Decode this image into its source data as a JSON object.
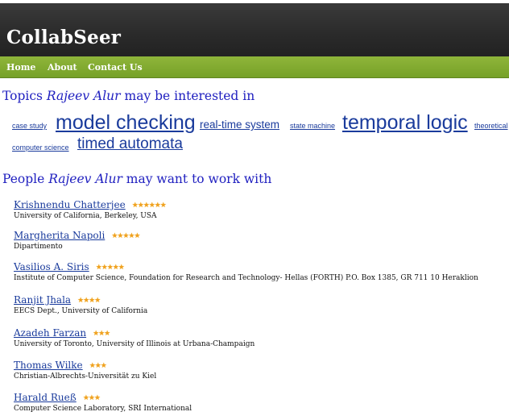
{
  "site": {
    "title": "CollabSeer"
  },
  "nav": {
    "items": [
      {
        "label": "Home"
      },
      {
        "label": "About"
      },
      {
        "label": "Contact Us"
      }
    ]
  },
  "topics": {
    "heading_prefix": "Topics ",
    "person": "Rajeev Alur",
    "heading_suffix": " may be interested in",
    "tags": [
      {
        "label": "case study"
      },
      {
        "label": "model checking"
      },
      {
        "label": "real-time system"
      },
      {
        "label": "state machine"
      },
      {
        "label": "temporal logic"
      },
      {
        "label": "theoretical"
      },
      {
        "label": "computer science"
      },
      {
        "label": "timed automata"
      }
    ]
  },
  "people": {
    "heading_prefix": "People ",
    "person": "Rajeev Alur",
    "heading_suffix": " may want to work with",
    "list": [
      {
        "name": "Krishnendu Chatterjee",
        "stars": 6,
        "affiliation": "University of California, Berkeley, USA"
      },
      {
        "name": "Margherita Napoli",
        "stars": 5,
        "affiliation": "Dipartimento"
      },
      {
        "name": "Vasilios A. Siris",
        "stars": 5,
        "affiliation": "Institute of Computer Science, Foundation for Research and Technology- Hellas (FORTH) P.O. Box 1385, GR 711 10 Heraklion"
      },
      {
        "name": "Ranjit Jhala",
        "stars": 4,
        "affiliation": "EECS Dept., University of California"
      },
      {
        "name": "Azadeh Farzan",
        "stars": 3,
        "affiliation": "University of Toronto, University of Illinois at Urbana-Champaign"
      },
      {
        "name": "Thomas Wilke",
        "stars": 3,
        "affiliation": "Christian-Albrechts-Universität zu Kiel"
      },
      {
        "name": "Harald Rueß",
        "stars": 3,
        "affiliation": "Computer Science Laboratory, SRI International"
      }
    ]
  },
  "colors": {
    "header": "#2a2a2a",
    "nav": "#7fa82e",
    "link": "#1a3b9c",
    "heading": "#2020c0",
    "star": "#f0a020"
  },
  "icons": {
    "rating": "star-icon"
  }
}
